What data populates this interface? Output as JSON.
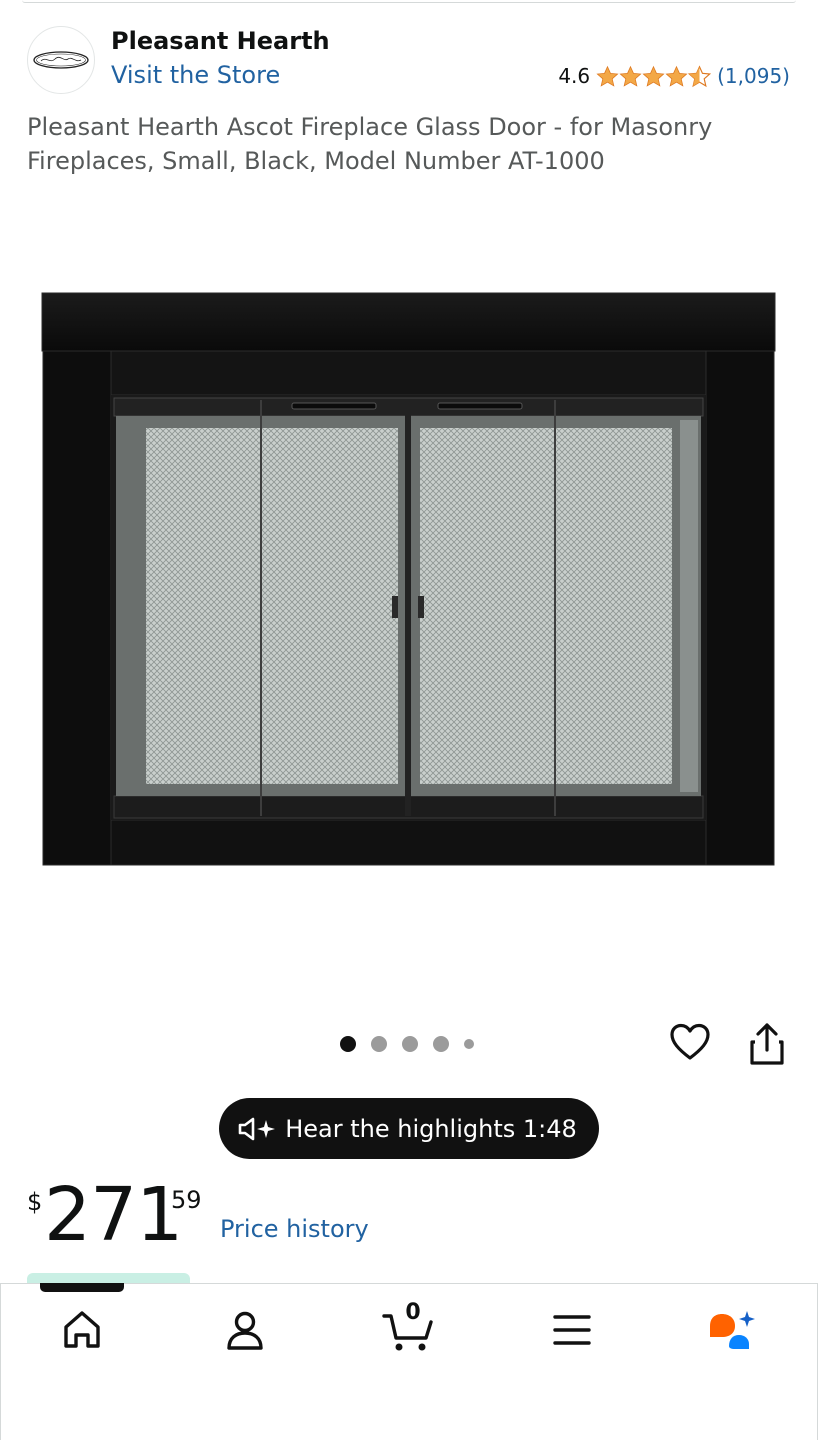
{
  "brand": {
    "name": "Pleasant Hearth",
    "logo_text": "Pleasant Hearth",
    "store_link": "Visit the Store"
  },
  "rating": {
    "value": "4.6",
    "count": "(1,095)",
    "stars": 4.6,
    "star_color": "#f3a847"
  },
  "product": {
    "title": "Pleasant Hearth Ascot Fireplace Glass Door - for Masonry Fireplaces, Small, Black, Model Number AT-1000",
    "image_icon": "fireplace-glass-door-image"
  },
  "carousel": {
    "total": 5,
    "active_index": 0
  },
  "actions": {
    "wishlist_icon": "heart-icon",
    "share_icon": "share-icon"
  },
  "audio": {
    "label": "Hear the highlights 1:48",
    "icon": "speaker-sparkle-icon"
  },
  "price": {
    "symbol": "$",
    "whole": "271",
    "fraction": "59",
    "history_link": "Price history"
  },
  "nav": {
    "items": [
      {
        "name": "home",
        "icon": "home-icon"
      },
      {
        "name": "account",
        "icon": "account-icon"
      },
      {
        "name": "cart",
        "icon": "cart-icon",
        "count": "0"
      },
      {
        "name": "menu",
        "icon": "menu-icon"
      },
      {
        "name": "rufus",
        "icon": "rufus-ai-icon"
      }
    ]
  },
  "colors": {
    "link": "#2162a1",
    "rufus_orange": "#ff6200",
    "rufus_blue": "#0a84ff"
  }
}
